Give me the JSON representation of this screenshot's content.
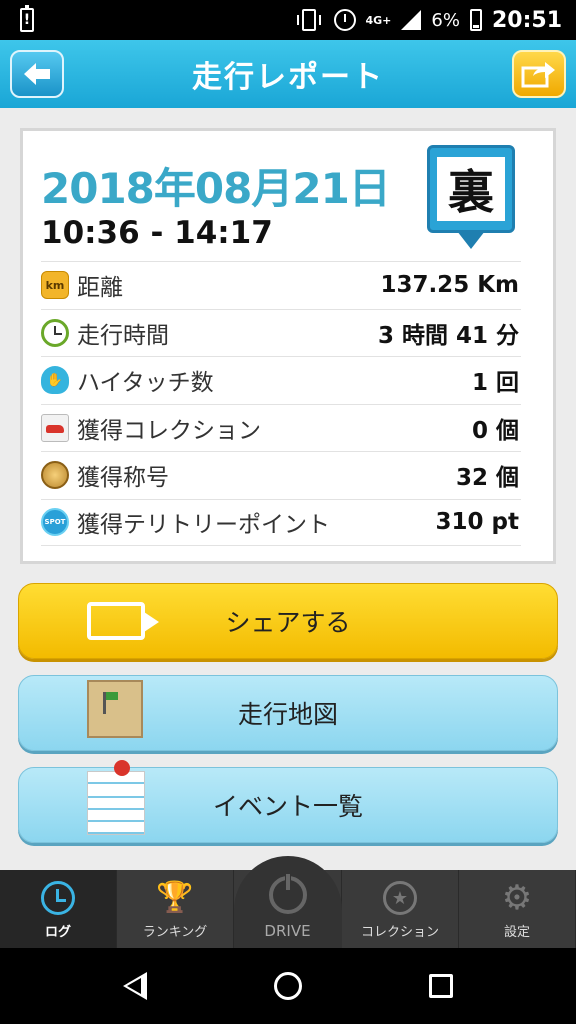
{
  "status_bar": {
    "battery_alert": "!",
    "network": "4G+",
    "battery_percent": "6%",
    "time": "20:51"
  },
  "header": {
    "title": "走行レポート",
    "back_icon": "arrow-left-icon",
    "share_icon": "share-arrow-icon"
  },
  "report": {
    "date": "2018年08月21日",
    "time_range": "10:36 - 14:17",
    "badge_char": "裏",
    "stats": [
      {
        "icon": "km-icon",
        "label": "距離",
        "value": "137.25 Km"
      },
      {
        "icon": "clock-icon",
        "label": "走行時間",
        "value": "3 時間 41 分"
      },
      {
        "icon": "hand-icon",
        "label": "ハイタッチ数",
        "value": "1 回"
      },
      {
        "icon": "car-icon",
        "label": "獲得コレクション",
        "value": "0 個"
      },
      {
        "icon": "title-medal-icon",
        "label": "獲得称号",
        "value": "32 個"
      },
      {
        "icon": "spot-icon",
        "label": "獲得テリトリーポイント",
        "value": "310 pt"
      }
    ]
  },
  "actions": {
    "share_label": "シェアする",
    "map_label": "走行地図",
    "events_label": "イベント一覧"
  },
  "tabs": {
    "log": "ログ",
    "ranking": "ランキング",
    "drive": "DRIVE",
    "collection": "コレクション",
    "settings": "設定"
  },
  "colors": {
    "header": "#1aa6d6",
    "date": "#3aa8c8",
    "share_button": "#f3bb00",
    "secondary_button": "#8cd6ef",
    "tab_bar": "#3a3a3a"
  }
}
